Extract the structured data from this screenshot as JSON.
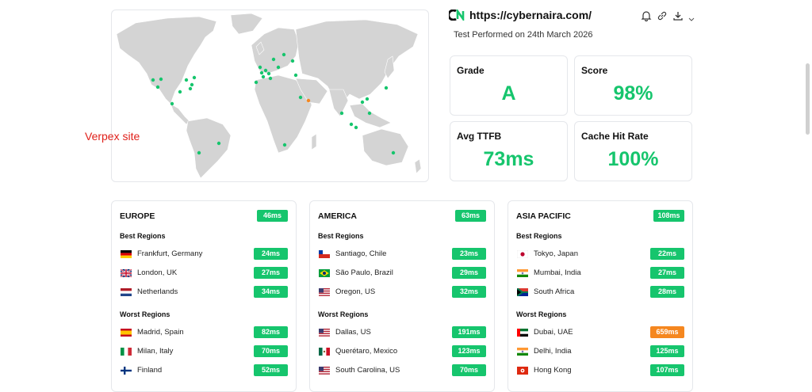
{
  "site": {
    "url": "https://cybernaira.com/",
    "test_date": "Test Performed on 24th March 2026",
    "annotation": "Verpex site"
  },
  "icons": {
    "logo": "cybernaira-logo",
    "notify": "bell-icon",
    "link": "link-icon",
    "download": "download-icon",
    "chevron": "chevron-down-icon"
  },
  "colors": {
    "good": "#16c56d",
    "warn": "#f5871f",
    "annotation": "#e0201a"
  },
  "metrics": [
    {
      "label": "Grade",
      "value": "A"
    },
    {
      "label": "Score",
      "value": "98%"
    },
    {
      "label": "Avg TTFB",
      "value": "73ms"
    },
    {
      "label": "Cache Hit Rate",
      "value": "100%"
    }
  ],
  "best_label": "Best Regions",
  "worst_label": "Worst Regions",
  "regions": [
    {
      "name": "EUROPE",
      "avg": "46ms",
      "best": [
        {
          "flag": "germany-flag",
          "name": "Frankfurt, Germany",
          "time": "24ms",
          "status": "good"
        },
        {
          "flag": "uk-flag",
          "name": "London, UK",
          "time": "27ms",
          "status": "good"
        },
        {
          "flag": "netherlands-flag",
          "name": "Netherlands",
          "time": "34ms",
          "status": "good"
        }
      ],
      "worst": [
        {
          "flag": "spain-flag",
          "name": "Madrid, Spain",
          "time": "82ms",
          "status": "good"
        },
        {
          "flag": "italy-flag",
          "name": "Milan, Italy",
          "time": "70ms",
          "status": "good"
        },
        {
          "flag": "finland-flag",
          "name": "Finland",
          "time": "52ms",
          "status": "good"
        }
      ]
    },
    {
      "name": "AMERICA",
      "avg": "63ms",
      "best": [
        {
          "flag": "chile-flag",
          "name": "Santiago, Chile",
          "time": "23ms",
          "status": "good"
        },
        {
          "flag": "brazil-flag",
          "name": "São Paulo, Brazil",
          "time": "29ms",
          "status": "good"
        },
        {
          "flag": "us-flag",
          "name": "Oregon, US",
          "time": "32ms",
          "status": "good"
        }
      ],
      "worst": [
        {
          "flag": "us-flag",
          "name": "Dallas, US",
          "time": "191ms",
          "status": "good"
        },
        {
          "flag": "mexico-flag",
          "name": "Querétaro, Mexico",
          "time": "123ms",
          "status": "good"
        },
        {
          "flag": "us-flag",
          "name": "South Carolina, US",
          "time": "70ms",
          "status": "good"
        }
      ]
    },
    {
      "name": "ASIA PACIFIC",
      "avg": "108ms",
      "best": [
        {
          "flag": "japan-flag",
          "name": "Tokyo, Japan",
          "time": "22ms",
          "status": "good"
        },
        {
          "flag": "india-flag",
          "name": "Mumbai, India",
          "time": "27ms",
          "status": "good"
        },
        {
          "flag": "south-africa-flag",
          "name": "South Africa",
          "time": "28ms",
          "status": "good"
        }
      ],
      "worst": [
        {
          "flag": "uae-flag",
          "name": "Dubai, UAE",
          "time": "659ms",
          "status": "warn"
        },
        {
          "flag": "india-flag",
          "name": "Delhi, India",
          "time": "125ms",
          "status": "good"
        },
        {
          "flag": "hong-kong-flag",
          "name": "Hong Kong",
          "time": "107ms",
          "status": "good"
        }
      ]
    }
  ]
}
